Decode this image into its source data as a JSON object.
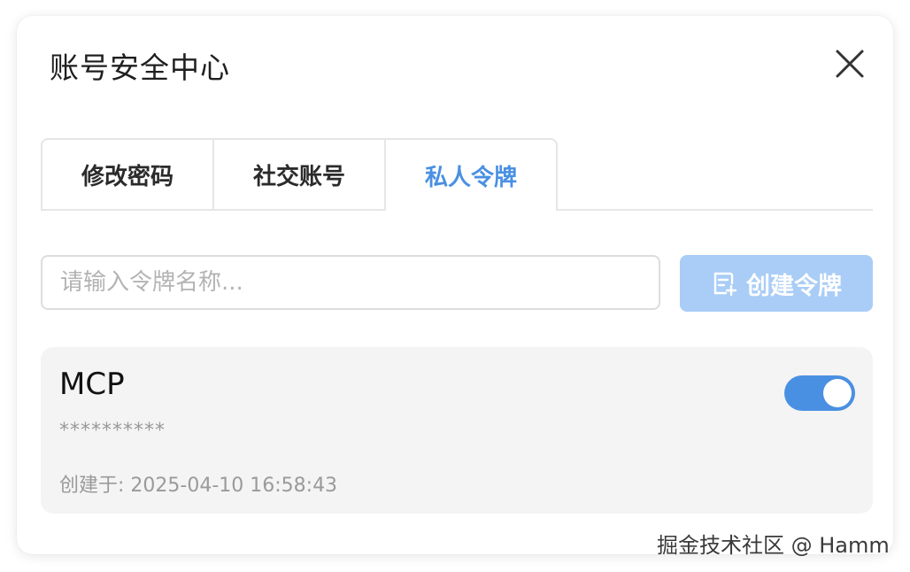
{
  "dialog": {
    "title": "账号安全中心"
  },
  "tabs": [
    {
      "label": "修改密码",
      "active": false
    },
    {
      "label": "社交账号",
      "active": false
    },
    {
      "label": "私人令牌",
      "active": true
    }
  ],
  "token_form": {
    "input_placeholder": "请输入令牌名称...",
    "input_value": "",
    "create_button_label": "创建令牌"
  },
  "tokens": [
    {
      "name": "MCP",
      "masked_value": "**********",
      "created_label": "创建于: 2025-04-10 16:58:43",
      "enabled": true
    }
  ],
  "watermark": "掘金技术社区 @ Hamm",
  "colors": {
    "accent": "#4a90e2",
    "button_disabled": "#a9cdf6",
    "card_bg": "#f4f4f4"
  },
  "icons": {
    "close": "close-icon",
    "create": "add-document-icon"
  }
}
